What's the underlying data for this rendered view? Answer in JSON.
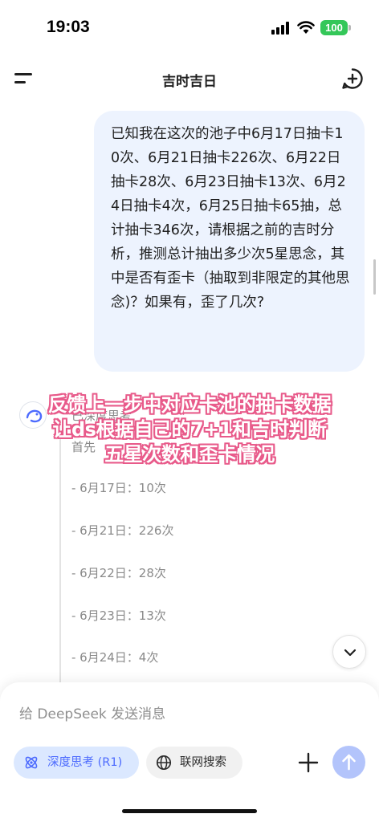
{
  "status_bar": {
    "time": "19:03",
    "battery": "100"
  },
  "header": {
    "title": "吉时吉日",
    "menu_icon": "menu-icon",
    "new_chat_icon": "new-chat-icon"
  },
  "user_message": "已知我在这次的池子中6月17日抽卡10次、6月21日抽卡226次、6月22日抽卡28次、6月23日抽卡13次、6月24日抽卡4次，6月25日抽卡65抽，总计抽卡346次，请根据之前的吉时分析，推测总计抽出多少次5星思念，其中是否有歪卡（抽取到非限定的其他思念)？如果有，歪了几次?",
  "assistant": {
    "think_title": "已深度思考",
    "think_first_line": "首先",
    "draw_list": [
      "- 6月17日：10次",
      "- 6月21日：226次",
      "- 6月22日：28次",
      "- 6月23日：13次",
      "- 6月24日：4次"
    ]
  },
  "overlay_caption": [
    "反馈上一步中对应卡池的抽卡数据",
    "让ds根据自己的7+1和吉时判断",
    "五星次数和歪卡情况"
  ],
  "composer": {
    "placeholder": "给 DeepSeek 发送消息",
    "deep_think_label": "深度思考 (R1)",
    "web_search_label": "联网搜索"
  },
  "colors": {
    "accent": "#4d6bfe",
    "bubble": "#edf3fe",
    "overlay_stroke": "#e85a8a",
    "battery": "#34c759"
  }
}
